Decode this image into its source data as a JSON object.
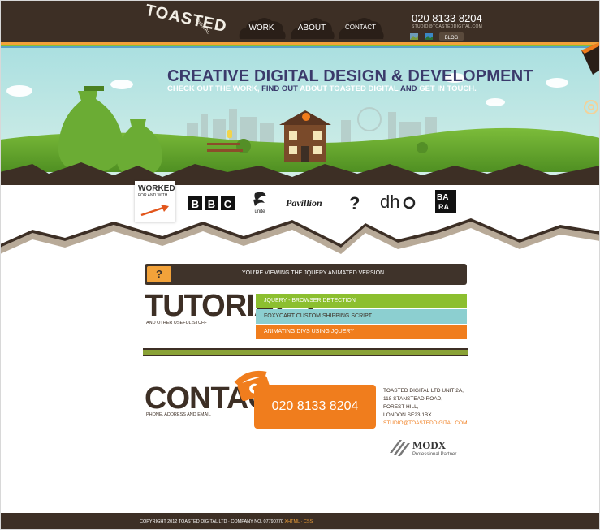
{
  "header": {
    "logo_text": "TOASTED",
    "logo_subtext": "DIGITAL",
    "nav": [
      {
        "label": "WORK"
      },
      {
        "label": "ABOUT"
      },
      {
        "label": "CONTACT"
      }
    ],
    "phone": "020 8133 8204",
    "email": "STUDIO@TOASTEDDIGITAL.COM",
    "blog_label": "BLOG"
  },
  "hero": {
    "title": "CREATIVE DIGITAL DESIGN & DEVELOPMENT",
    "sub_part1": "CHECK OUT THE WORK,",
    "sub_part2": "FIND OUT",
    "sub_part3": "ABOUT TOASTED DIGITAL",
    "sub_part4": "AND",
    "sub_part5": "GET IN TOUCH."
  },
  "clients": {
    "worked_title": "WORKED",
    "worked_sub": "FOR AND WITH",
    "logos": [
      "BBC",
      "unite",
      "Pavillion",
      "?",
      "dh",
      "BA"
    ]
  },
  "banner": {
    "badge": "?",
    "message": "YOU'RE VIEWING THE JQUERY ANIMATED VERSION."
  },
  "tutorials": {
    "heading": "TUTORIALS",
    "subheading": "AND OTHER USEFUL STUFF",
    "items": [
      {
        "label": "JQUERY - BROWSER DETECTION",
        "color": "#8cbf2f"
      },
      {
        "label": "FOXYCART  CUSTOM SHIPPING SCRIPT",
        "color": "#8ccfd0"
      },
      {
        "label": "ANIMATING DIVS USING JQUERY",
        "color": "#f07d1d"
      }
    ]
  },
  "contact": {
    "heading": "CONTACT",
    "subheading": "PHONE, ADDRESS AND EMAIL",
    "phone": "020 8133 8204",
    "address_lines": [
      "TOASTED DIGITAL LTD UNIT 2A,",
      "118 STANSTEAD ROAD,",
      "FOREST HILL,",
      "LONDON SE23 1BX"
    ],
    "email": "STUDIO@TOASTEDDIGITAL.COM",
    "partner_name": "MODX",
    "partner_sub": "Professional Partner"
  },
  "footer": {
    "text": "COPYRIGHT 2012 TOASTED DIGITAL LTD · COMPANY NO. 07790770",
    "link_xhtml": "XHTML",
    "separator": "·",
    "link_css": "CSS"
  },
  "colors": {
    "dark_brown": "#3d2f25",
    "orange": "#f07d1d",
    "green": "#8cbf2f",
    "teal": "#8ccfd0",
    "navy_text": "#3b3a6b",
    "sky": "#bfe6e8"
  }
}
